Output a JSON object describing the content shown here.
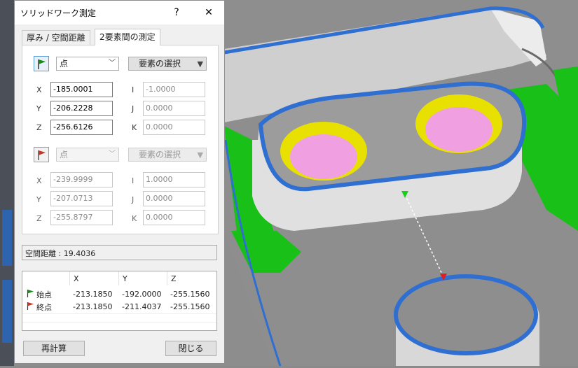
{
  "dialog": {
    "title": "ソリッドワーク測定",
    "help_label": "?",
    "close_label": "✕",
    "tabs": [
      {
        "label": "厚み / 空間距離",
        "active": false
      },
      {
        "label": "2要素間の測定",
        "active": true
      }
    ],
    "start": {
      "type_value": "点",
      "select_button": "要素の選択",
      "x_label": "X",
      "y_label": "Y",
      "z_label": "Z",
      "i_label": "I",
      "j_label": "J",
      "k_label": "K",
      "x": "-185.0001",
      "y": "-206.2228",
      "z": "-256.6126",
      "i": "-1.0000",
      "j": "0.0000",
      "k": "0.0000"
    },
    "end": {
      "type_value": "点",
      "select_button": "要素の選択",
      "x_label": "X",
      "y_label": "Y",
      "z_label": "Z",
      "i_label": "I",
      "j_label": "J",
      "k_label": "K",
      "x": "-239.9999",
      "y": "-207.0713",
      "z": "-255.8797",
      "i": "1.0000",
      "j": "0.0000",
      "k": "0.0000"
    },
    "distance_text": "空間距離 : 19.4036",
    "table": {
      "headers": [
        "",
        "X",
        "Y",
        "Z"
      ],
      "rows": [
        {
          "label": "始点",
          "x": "-213.1850",
          "y": "-192.0000",
          "z": "-255.1560"
        },
        {
          "label": "終点",
          "x": "-213.1850",
          "y": "-211.4037",
          "z": "-255.1560"
        }
      ]
    },
    "recalc_button": "再計算",
    "close_button": "閉じる"
  },
  "colors": {
    "start_flag": "#1a8a1a",
    "end_flag": "#c0392b",
    "part_face": "#d9d9d9",
    "edge_blue": "#2f6fd1",
    "green_surface": "#18c018",
    "hole_yellow": "#e8e000",
    "hole_pink": "#f0a0e0"
  }
}
